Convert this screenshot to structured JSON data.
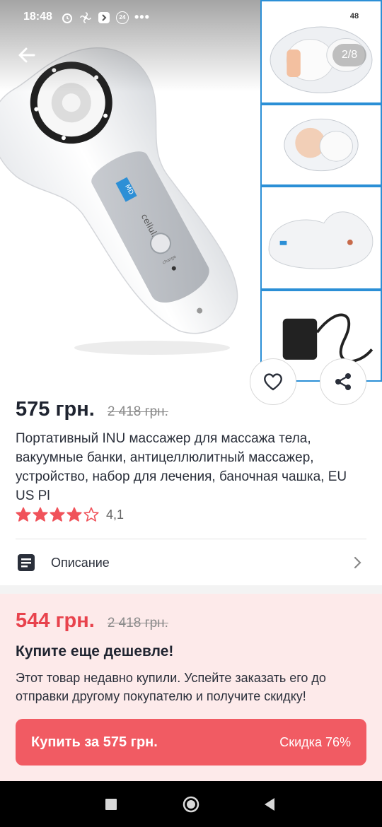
{
  "status_bar": {
    "time": "18:48",
    "notification_badge": "24",
    "battery": "48",
    "icons": [
      "alarm-icon",
      "fan-icon",
      "app-icon",
      "badge-icon",
      "more-dots-icon",
      "signal-icon",
      "wifi-icon",
      "battery-icon"
    ]
  },
  "gallery": {
    "page_counter": "2/8",
    "device_text": "cellulless",
    "device_brand": "MD",
    "charge_text": "charge",
    "thumbnails": [
      "cups-in-case",
      "cups-side-view",
      "charging-base",
      "power-adapter"
    ]
  },
  "product": {
    "price": "575 грн.",
    "old_price": "2 418 грн.",
    "title": "Портативный INU массажер для массажа тела, вакуумные банки, антицеллюлитный массажер, устройство, набор для лечения, баночная чашка, EU US Pl",
    "rating": 4.1,
    "rating_text": "4,1",
    "stars_filled": 4,
    "stars_total": 5
  },
  "description_row": {
    "label": "Описание"
  },
  "promo": {
    "price": "544 грн.",
    "old_price": "2 418 грн.",
    "title": "Купите еще дешевле!",
    "text": "Этот товар недавно купили. Успейте заказать его до отправки другому покупателю и получите скидку!",
    "buy_label": "Купить за 575 грн.",
    "discount_label": "Скидка 76%"
  },
  "colors": {
    "accent": "#f15b63",
    "promo_price": "#e8434d",
    "promo_bg": "#fdeaea",
    "star": "#f0525a",
    "thumb_border": "#2b8fd6"
  }
}
